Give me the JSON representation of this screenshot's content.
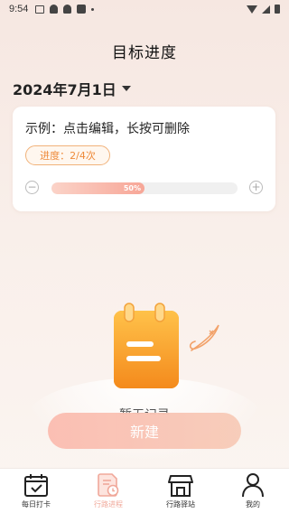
{
  "status_bar": {
    "time": "9:54"
  },
  "header": {
    "title": "目标进度"
  },
  "date_selector": {
    "date": "2024年7月1日"
  },
  "goal_card": {
    "title": "示例：点击编辑，长按可删除",
    "progress_label": "进度：2/4次",
    "progress_fraction": 0.5,
    "progress_percent_text": "50%",
    "minus_symbol": "−",
    "plus_symbol": "+"
  },
  "empty_state": {
    "text": "暂无记录"
  },
  "new_button": {
    "label": "新建"
  },
  "tabbar": {
    "items": [
      {
        "label": "每日打卡",
        "icon": "calendar-check-icon",
        "active": false
      },
      {
        "label": "行路进程",
        "icon": "document-clock-icon",
        "active": true
      },
      {
        "label": "行路驿站",
        "icon": "store-icon",
        "active": false
      },
      {
        "label": "我的",
        "icon": "person-icon",
        "active": false
      }
    ]
  },
  "colors": {
    "accent_orange": "#ee8a3a",
    "progress_fill": "#f7a697",
    "active_tab": "#f0a89a",
    "button_gradient_start": "#fbbcb0",
    "illustration_orange": "#f8a224"
  }
}
